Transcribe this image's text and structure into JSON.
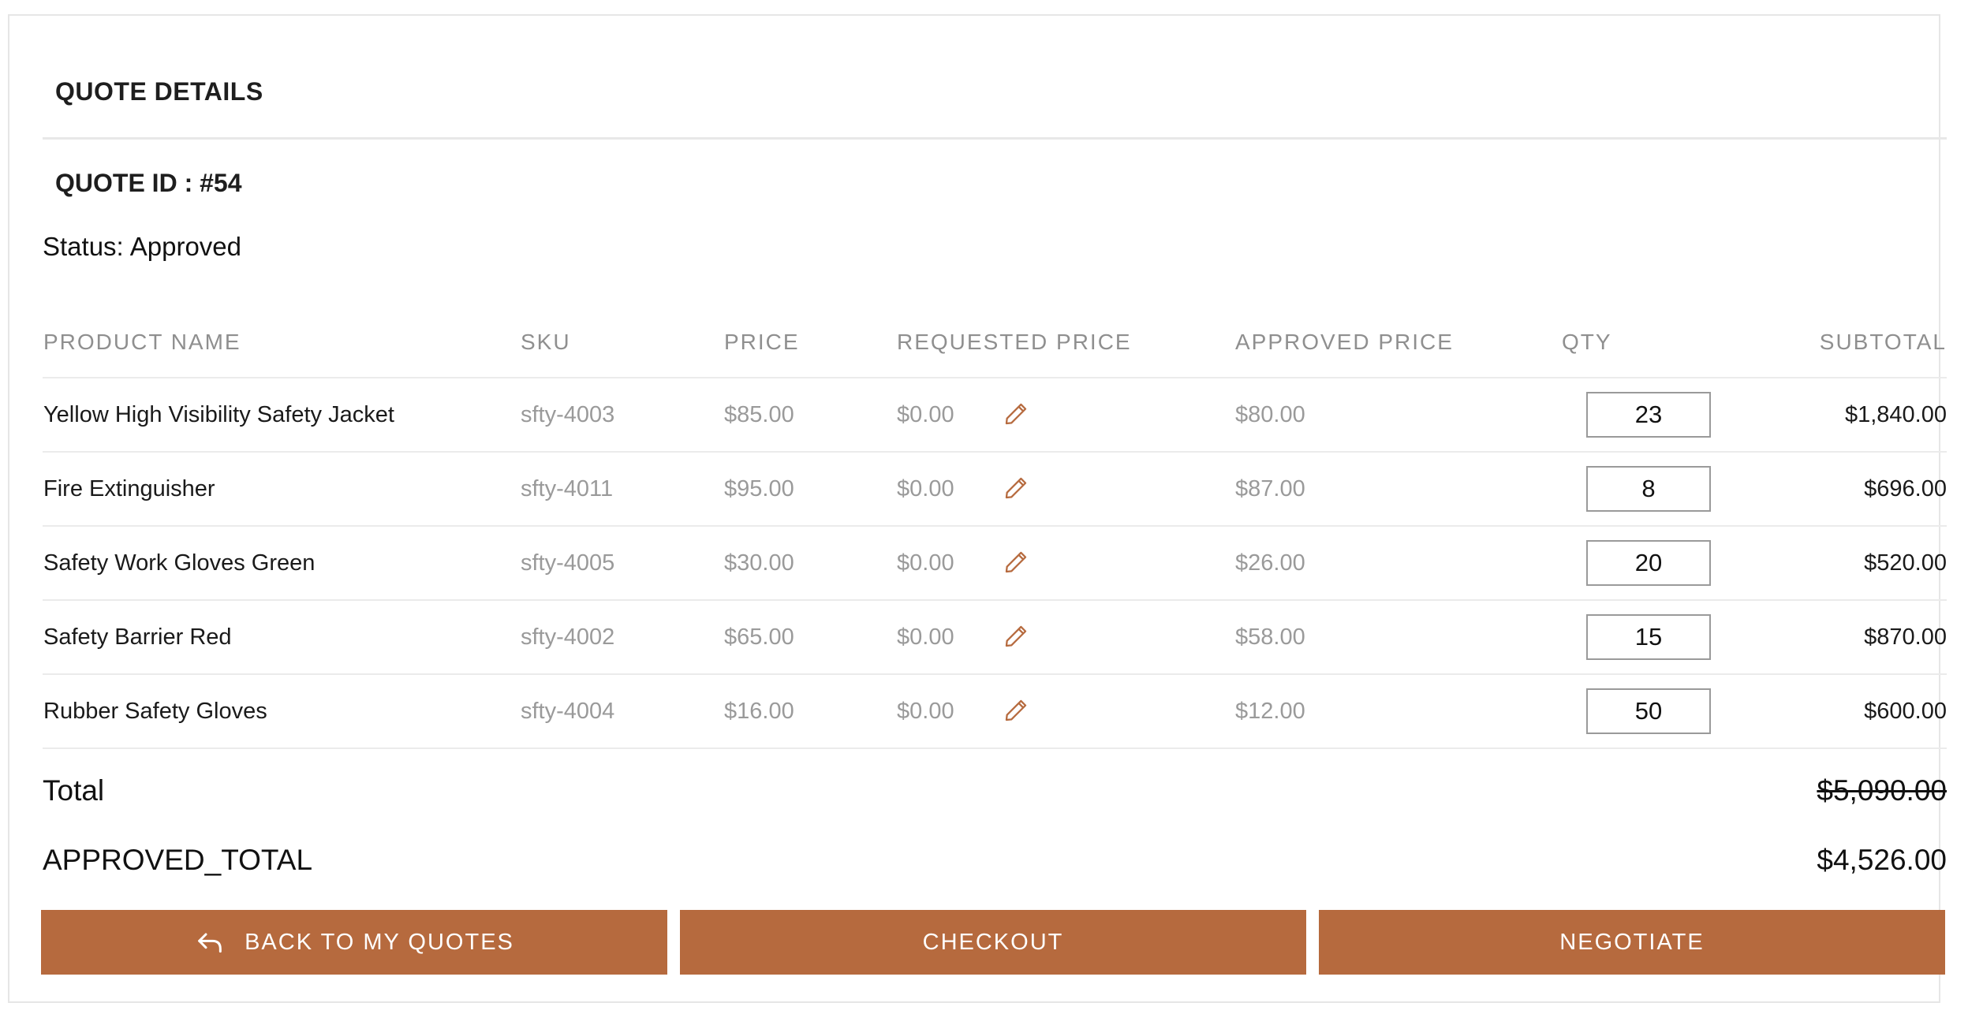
{
  "page": {
    "title": "QUOTE DETAILS",
    "quote_id_label": "QUOTE ID : #54",
    "status_label": "Status:",
    "status_value": "Approved"
  },
  "table": {
    "headers": {
      "product_name": "PRODUCT NAME",
      "sku": "SKU",
      "price": "PRICE",
      "requested_price": "REQUESTED PRICE",
      "approved_price": "APPROVED PRICE",
      "qty": "QTY",
      "subtotal": "SUBTOTAL"
    },
    "rows": [
      {
        "name": "Yellow High Visibility Safety Jacket",
        "sku": "sfty-4003",
        "price": "$85.00",
        "requested_price": "$0.00",
        "approved_price": "$80.00",
        "qty": "23",
        "subtotal": "$1,840.00"
      },
      {
        "name": "Fire Extinguisher",
        "sku": "sfty-4011",
        "price": "$95.00",
        "requested_price": "$0.00",
        "approved_price": "$87.00",
        "qty": "8",
        "subtotal": "$696.00"
      },
      {
        "name": "Safety Work Gloves Green",
        "sku": "sfty-4005",
        "price": "$30.00",
        "requested_price": "$0.00",
        "approved_price": "$26.00",
        "qty": "20",
        "subtotal": "$520.00"
      },
      {
        "name": "Safety Barrier Red",
        "sku": "sfty-4002",
        "price": "$65.00",
        "requested_price": "$0.00",
        "approved_price": "$58.00",
        "qty": "15",
        "subtotal": "$870.00"
      },
      {
        "name": "Rubber Safety Gloves",
        "sku": "sfty-4004",
        "price": "$16.00",
        "requested_price": "$0.00",
        "approved_price": "$12.00",
        "qty": "50",
        "subtotal": "$600.00"
      }
    ]
  },
  "totals": {
    "total_label": "Total",
    "total_value": "$5,090.00",
    "approved_label": "APPROVED_TOTAL",
    "approved_value": "$4,526.00"
  },
  "buttons": {
    "back_label": "BACK TO MY QUOTES",
    "checkout_label": "CHECKOUT",
    "negotiate_label": "NEGOTIATE"
  },
  "icons": {
    "edit": "pencil-icon",
    "back": "reply-arrow-icon"
  },
  "colors": {
    "accent": "#b66a3e",
    "muted_text": "#9a9a9a",
    "border": "#ebebeb"
  }
}
